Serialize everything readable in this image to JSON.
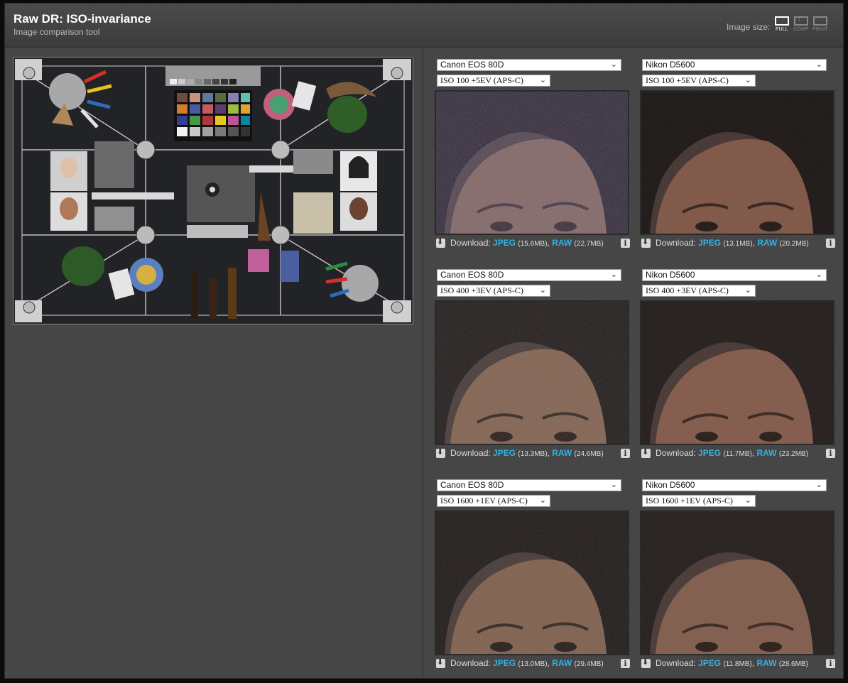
{
  "header": {
    "title": "Raw DR: ISO-invariance",
    "subtitle": "Image comparison tool",
    "image_size_label": "Image size:",
    "size_options": [
      {
        "label": "FULL",
        "active": true
      },
      {
        "label": "COMP",
        "active": false
      },
      {
        "label": "PRINT",
        "active": false
      }
    ]
  },
  "download_label": "Download:",
  "jpeg_label": "JPEG",
  "raw_label": "RAW",
  "cells": [
    {
      "camera": "Canon EOS 80D",
      "iso": "ISO 100 +5EV (APS-C)",
      "jpeg_size": "(15.6MB)",
      "raw_size": "(22.7MB)"
    },
    {
      "camera": "Nikon D5600",
      "iso": "ISO 100 +5EV (APS-C)",
      "jpeg_size": "(13.1MB)",
      "raw_size": "(20.2MB)"
    },
    {
      "camera": "Canon EOS 80D",
      "iso": "ISO 400 +3EV (APS-C)",
      "jpeg_size": "(13.3MB)",
      "raw_size": "(24.6MB)"
    },
    {
      "camera": "Nikon D5600",
      "iso": "ISO 400 +3EV (APS-C)",
      "jpeg_size": "(11.7MB)",
      "raw_size": "(23.2MB)"
    },
    {
      "camera": "Canon EOS 80D",
      "iso": "ISO 1600 +1EV (APS-C)",
      "jpeg_size": "(13.0MB)",
      "raw_size": "(29.4MB)"
    },
    {
      "camera": "Nikon D5600",
      "iso": "ISO 1600 +1EV (APS-C)",
      "jpeg_size": "(11.8MB)",
      "raw_size": "(28.6MB)"
    }
  ]
}
